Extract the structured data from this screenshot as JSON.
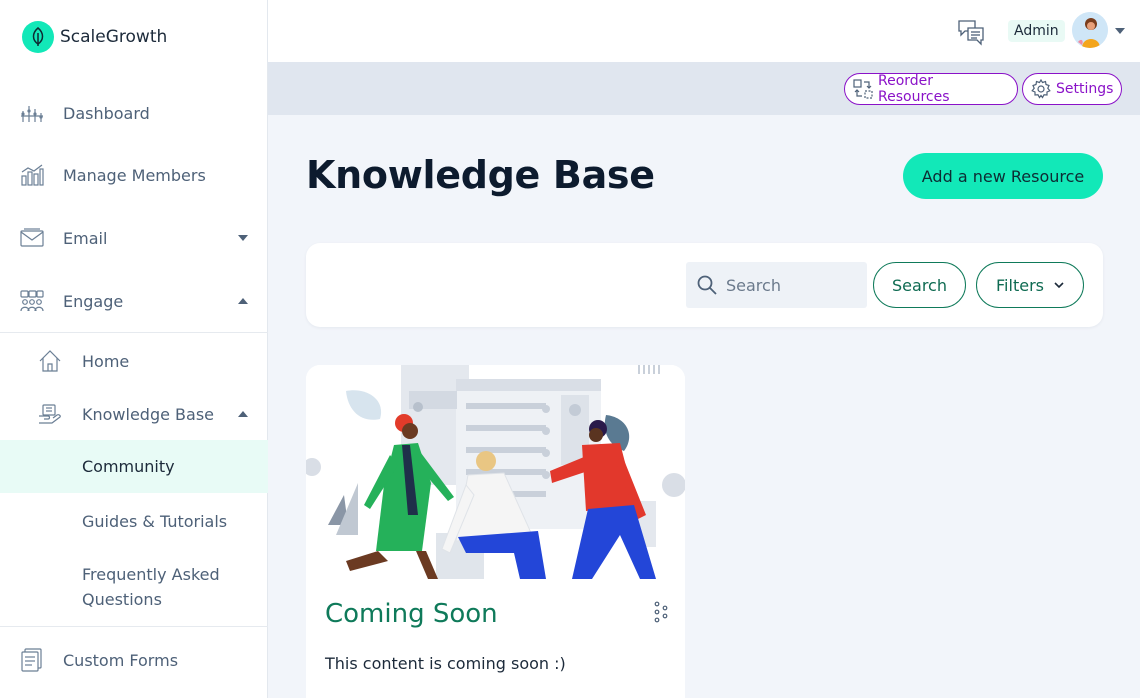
{
  "brand": {
    "name": "ScaleGrowth",
    "accent": "#12e8b8"
  },
  "sidebar": {
    "items": [
      {
        "label": "Dashboard",
        "icon": "dashboard-icon"
      },
      {
        "label": "Manage Members",
        "icon": "bar-chart-icon"
      },
      {
        "label": "Email",
        "icon": "envelope-icon"
      },
      {
        "label": "Engage",
        "icon": "group-icon"
      },
      {
        "label": "Home",
        "icon": "home-icon"
      },
      {
        "label": "Knowledge Base",
        "icon": "book-hand-icon"
      },
      {
        "label": "Community"
      },
      {
        "label": "Guides & Tutorials"
      },
      {
        "label": "Frequently Asked",
        "label_line2": "Questions"
      },
      {
        "label": "Custom Forms",
        "icon": "forms-icon"
      }
    ]
  },
  "topbar": {
    "admin_name": "Admin",
    "chat_icon": "chat-icon"
  },
  "actions": {
    "reorder_label": "Reorder Resources",
    "settings_label": "Settings"
  },
  "main": {
    "title": "Knowledge Base",
    "add_label": "Add a new Resource",
    "search_placeholder": "Search",
    "search_button": "Search",
    "filters_button": "Filters"
  },
  "card": {
    "title": "Coming Soon",
    "description": "This content is coming soon :)"
  },
  "colors": {
    "accent": "#12e8b8",
    "purple": "#8a12c8",
    "green_text": "#0f7a5a",
    "active_bg": "#e8fbf6"
  }
}
